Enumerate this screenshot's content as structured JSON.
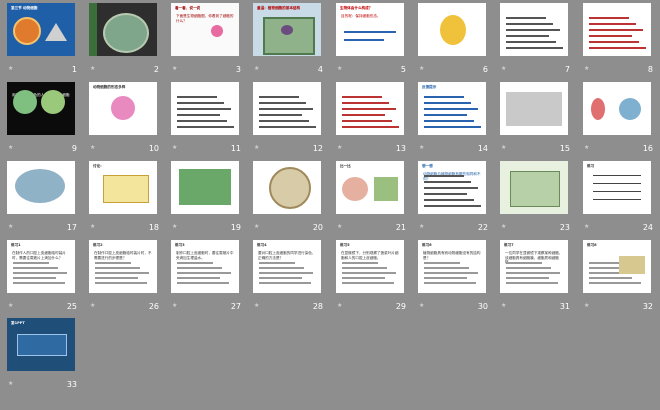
{
  "slides": [
    {
      "n": "1",
      "title": "第三节 动物细胞",
      "body": "",
      "bg": "#1f5fa8",
      "fg": "#ffffff",
      "art": "title-cell"
    },
    {
      "n": "2",
      "title": "",
      "body": "",
      "bg": "#2e2e2e",
      "fg": "#ffffff",
      "art": "cell-photo"
    },
    {
      "n": "3",
      "title": "看一看、说一说",
      "body": "下面是生物细胞图，你看到了细胞的什么？",
      "bg": "#fafafa",
      "fg": "#a00000",
      "art": "flower"
    },
    {
      "n": "4",
      "title": "重温：植物细胞的基本结构",
      "body": "",
      "bg": "#c9dbe6",
      "fg": "#b00000",
      "art": "plant-cell"
    },
    {
      "n": "5",
      "title": "生物体由什么构成？",
      "body": "目的呢：保持细胞形态。",
      "bg": "#ffffff",
      "fg": "#c00000",
      "art": "text-blue"
    },
    {
      "n": "6",
      "title": "",
      "body": "",
      "bg": "#ffffff",
      "fg": "#333333",
      "art": "yellow-blob"
    },
    {
      "n": "7",
      "title": "",
      "body": "",
      "bg": "#ffffff",
      "fg": "#333333",
      "art": "text-only"
    },
    {
      "n": "8",
      "title": "",
      "body": "",
      "bg": "#ffffff",
      "fg": "#333333",
      "art": "text-red"
    },
    {
      "n": "9",
      "title": "",
      "body": "用不同染料染色的人体口腔上皮细胞",
      "bg": "#0b0b0b",
      "fg": "#ffffff",
      "art": "micro-green"
    },
    {
      "n": "10",
      "title": "动物细胞的形态多样",
      "body": "",
      "bg": "#ffffff",
      "fg": "#333333",
      "art": "pink-flower"
    },
    {
      "n": "11",
      "title": "",
      "body": "",
      "bg": "#ffffff",
      "fg": "#333333",
      "art": "list"
    },
    {
      "n": "12",
      "title": "",
      "body": "",
      "bg": "#ffffff",
      "fg": "#333333",
      "art": "list"
    },
    {
      "n": "13",
      "title": "",
      "body": "",
      "bg": "#ffffff",
      "fg": "#a00000",
      "art": "text-red-lines"
    },
    {
      "n": "14",
      "title": "反馈提示",
      "body": "",
      "bg": "#ffffff",
      "fg": "#1f5fa8",
      "art": "list-blue"
    },
    {
      "n": "15",
      "title": "",
      "body": "",
      "bg": "#ffffff",
      "fg": "#333333",
      "art": "micro-gray"
    },
    {
      "n": "16",
      "title": "",
      "body": "",
      "bg": "#ffffff",
      "fg": "#333333",
      "art": "red-cells"
    },
    {
      "n": "17",
      "title": "",
      "body": "",
      "bg": "#ffffff",
      "fg": "#333333",
      "art": "cell3d"
    },
    {
      "n": "18",
      "title": "讨论：",
      "body": "",
      "bg": "#ffffff",
      "fg": "#333333",
      "art": "yellow-box"
    },
    {
      "n": "19",
      "title": "",
      "body": "",
      "bg": "#ffffff",
      "fg": "#333333",
      "art": "green-cell"
    },
    {
      "n": "20",
      "title": "",
      "body": "",
      "bg": "#ffffff",
      "fg": "#333333",
      "art": "round-cell"
    },
    {
      "n": "21",
      "title": "比一比",
      "body": "",
      "bg": "#ffffff",
      "fg": "#333333",
      "art": "compare"
    },
    {
      "n": "22",
      "title": "想一想",
      "body": "动物细胞与植物细胞有哪些相同和不同？",
      "bg": "#ffffff",
      "fg": "#1f5fa8",
      "art": "text-only"
    },
    {
      "n": "23",
      "title": "",
      "body": "",
      "bg": "#e8f0e0",
      "fg": "#333333",
      "art": "diagram-cell"
    },
    {
      "n": "24",
      "title": "练习",
      "body": "",
      "bg": "#ffffff",
      "fg": "#333333",
      "art": "diagram"
    },
    {
      "n": "25",
      "title": "练习1",
      "body": "在制作人的口腔上皮细胞临时装片时，需要往载玻片上滴加什么？",
      "bg": "#ffffff",
      "fg": "#333333",
      "art": "question"
    },
    {
      "n": "26",
      "title": "练习2",
      "body": "在制作口腔上皮细胞临时装片时，不需要进行的步骤是？",
      "bg": "#ffffff",
      "fg": "#333333",
      "art": "question"
    },
    {
      "n": "27",
      "title": "练习3",
      "body": "制作口腔上皮细胞时，要往载玻片中央滴加生理盐水。",
      "bg": "#ffffff",
      "fg": "#333333",
      "art": "question"
    },
    {
      "n": "28",
      "title": "练习4",
      "body": "要对口腔上皮细胞的同学进行染色，正确的方法是？",
      "bg": "#ffffff",
      "fg": "#333333",
      "art": "question"
    },
    {
      "n": "29",
      "title": "练习5",
      "body": "在显微镜下，分别观察了菠菜叶片细胞和人的口腔上皮细胞。",
      "bg": "#ffffff",
      "fg": "#333333",
      "art": "question"
    },
    {
      "n": "30",
      "title": "练习6",
      "body": "植物细胞具有而动物细胞没有的结构是？",
      "bg": "#ffffff",
      "fg": "#333333",
      "art": "question"
    },
    {
      "n": "31",
      "title": "练习7",
      "body": "一位同学在显微镜下观察某种细胞，该细胞具有细胞膜、细胞质和细胞核。",
      "bg": "#ffffff",
      "fg": "#333333",
      "art": "question"
    },
    {
      "n": "32",
      "title": "练习8",
      "body": "",
      "bg": "#ffffff",
      "fg": "#333333",
      "art": "question-image"
    },
    {
      "n": "33",
      "title": "第1PPT",
      "body": "",
      "bg": "#1f4e79",
      "fg": "#ffffff",
      "art": "logo"
    }
  ]
}
